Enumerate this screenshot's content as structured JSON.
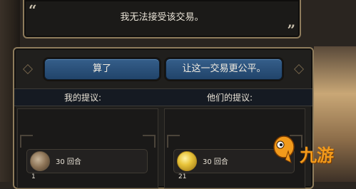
{
  "dialog": {
    "quote_open": "“",
    "quote_close": "”",
    "message": "我无法接受该交易。"
  },
  "trade": {
    "cancel_button": "算了",
    "fair_button": "让这一交易更公平。",
    "my_offer_label": "我的提议:",
    "their_offer_label": "他们的提议:",
    "my_items": [
      {
        "icon": "wood-resource-icon",
        "label": "30 回合",
        "quantity": "1"
      }
    ],
    "their_items": [
      {
        "icon": "gold-coin-icon",
        "label": "30 回合",
        "quantity": "21"
      }
    ]
  },
  "watermark": {
    "text": "九游",
    "logo": "9you-mascot-icon"
  },
  "colors": {
    "frame_gold": "#8e7c5c",
    "button_blue": "#2b517a",
    "text": "#e8e2d6",
    "logo_orange": "#f29a1b"
  }
}
